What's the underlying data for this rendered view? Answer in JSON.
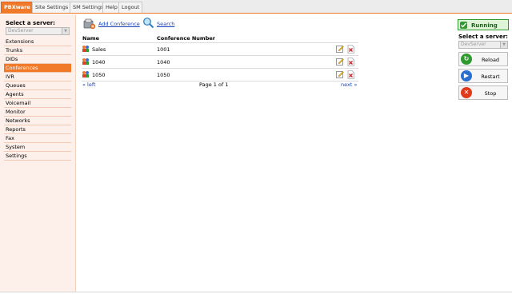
{
  "top_nav": {
    "tabs": [
      {
        "label": "PBXware",
        "active": true
      },
      {
        "label": "Site Settings",
        "active": false
      },
      {
        "label": "SM Settings",
        "active": false
      },
      {
        "label": "Help",
        "active": false
      },
      {
        "label": "Logout",
        "active": false
      }
    ]
  },
  "sidebar": {
    "select_title": "Select a server:",
    "select_value": "DevServer",
    "items": [
      {
        "label": "Extensions"
      },
      {
        "label": "Trunks"
      },
      {
        "label": "DIDs"
      },
      {
        "label": "Conferences",
        "active": true
      },
      {
        "label": "IVR"
      },
      {
        "label": "Queues"
      },
      {
        "label": "Agents"
      },
      {
        "label": "Voicemail"
      },
      {
        "label": "Monitor"
      },
      {
        "label": "Networks"
      },
      {
        "label": "Reports"
      },
      {
        "label": "Fax"
      },
      {
        "label": "System"
      },
      {
        "label": "Settings"
      }
    ]
  },
  "main": {
    "actions": {
      "add_label": "Add Conference",
      "search_label": "Search"
    },
    "table": {
      "headers": [
        "Name",
        "Conference Number"
      ],
      "rows": [
        {
          "name": "Sales",
          "number": "1001"
        },
        {
          "name": "1040",
          "number": "1040"
        },
        {
          "name": "1050",
          "number": "1050"
        }
      ]
    },
    "pager": {
      "prev": "« left",
      "info": "Page 1 of 1",
      "next": "next »"
    }
  },
  "right_panel": {
    "status": "Running",
    "select_title": "Select a server:",
    "select_value": "DevServer",
    "buttons": [
      {
        "label": "Reload",
        "icon": "reload-icon"
      },
      {
        "label": "Restart",
        "icon": "restart-icon"
      },
      {
        "label": "Stop",
        "icon": "stop-icon"
      }
    ]
  },
  "colors": {
    "accent": "#f07a2a",
    "sidebar_bg": "#fdf0ea",
    "link": "#1a43b8",
    "running": "#2f9a2f"
  }
}
